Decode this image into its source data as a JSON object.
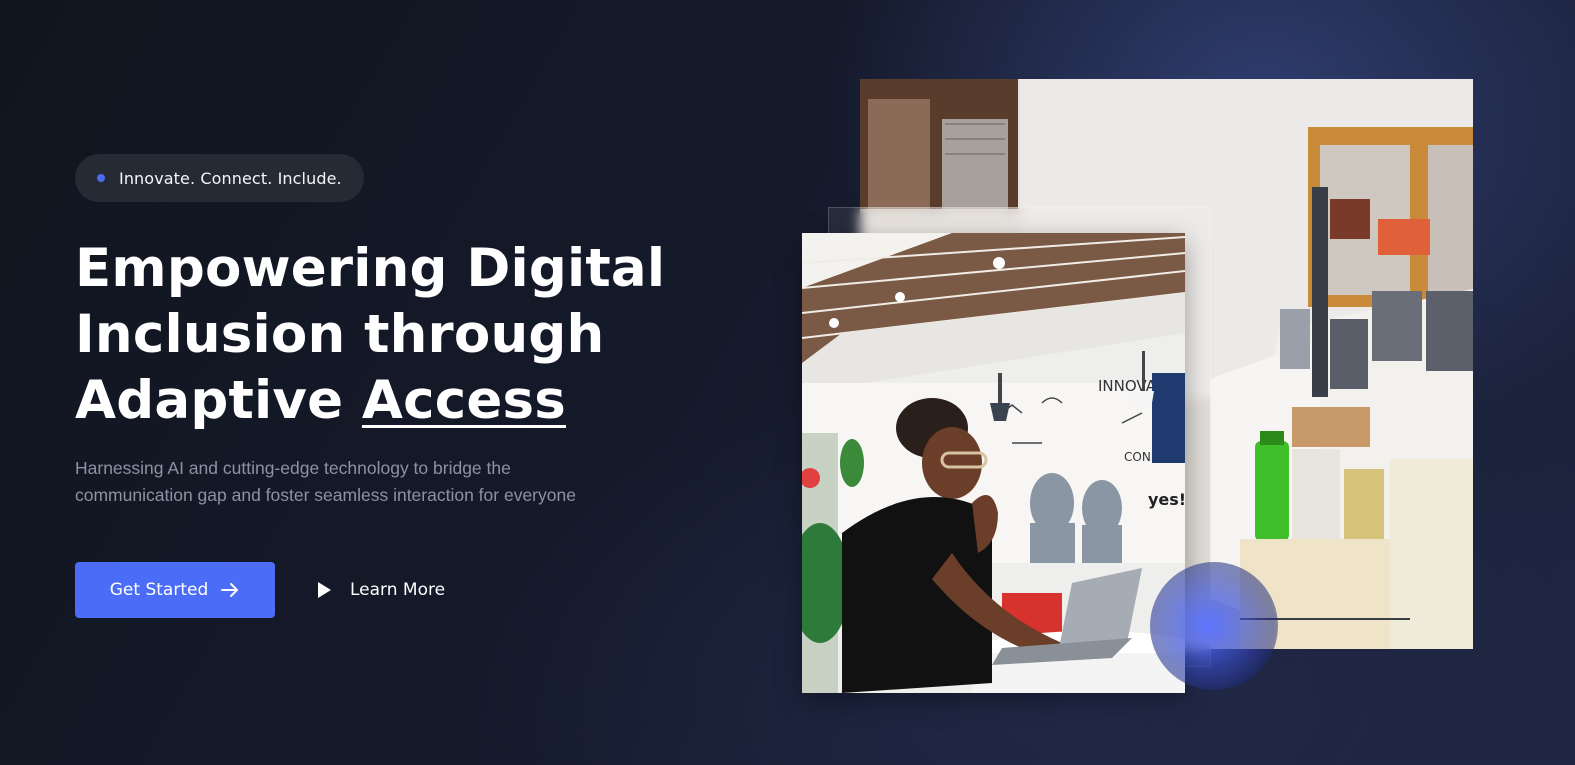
{
  "hero": {
    "badge_text": "Innovate. Connect. Include.",
    "headline_line1": "Empowering Digital",
    "headline_line2": "Inclusion through",
    "headline_line3_prefix": "Adaptive ",
    "headline_highlight": "Access",
    "subtext_line1": "Harnessing AI and cutting-edge technology to bridge the",
    "subtext_line2": "communication gap and foster seamless interaction for everyone",
    "primary_cta": "Get Started",
    "secondary_cta": "Learn More"
  },
  "media": {
    "back_image_alt": "Office workspace with desktop computers",
    "front_image_alt": "Woman working on a laptop in a coworking space",
    "mural_text_1": "INNOVA",
    "mural_text_2": "CONNECT",
    "mural_text_3": "yes!"
  },
  "colors": {
    "accent": "#4a6cf7",
    "badge_bg": "#262a35",
    "subtext": "#8c92a3"
  },
  "icons": {
    "badge": "dot-icon",
    "primary_cta": "arrow-right-icon",
    "secondary_cta": "play-icon"
  }
}
